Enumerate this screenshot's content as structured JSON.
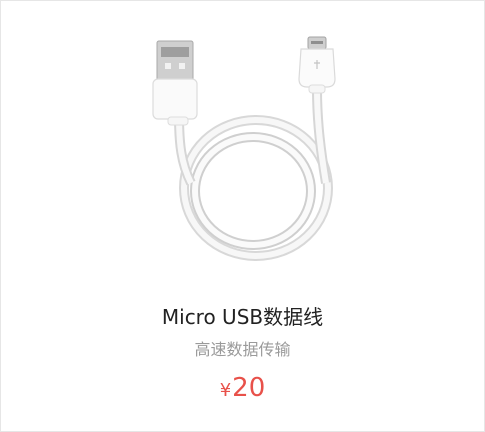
{
  "product": {
    "name": "Micro USB数据线",
    "subtitle": "高速数据传输",
    "currency_symbol": "¥",
    "price": "20",
    "image_icon": "micro-usb-cable-icon"
  },
  "colors": {
    "price": "#e8514a",
    "subtitle": "#9a9a9a",
    "name": "#222222",
    "border": "#e6e6e6"
  }
}
